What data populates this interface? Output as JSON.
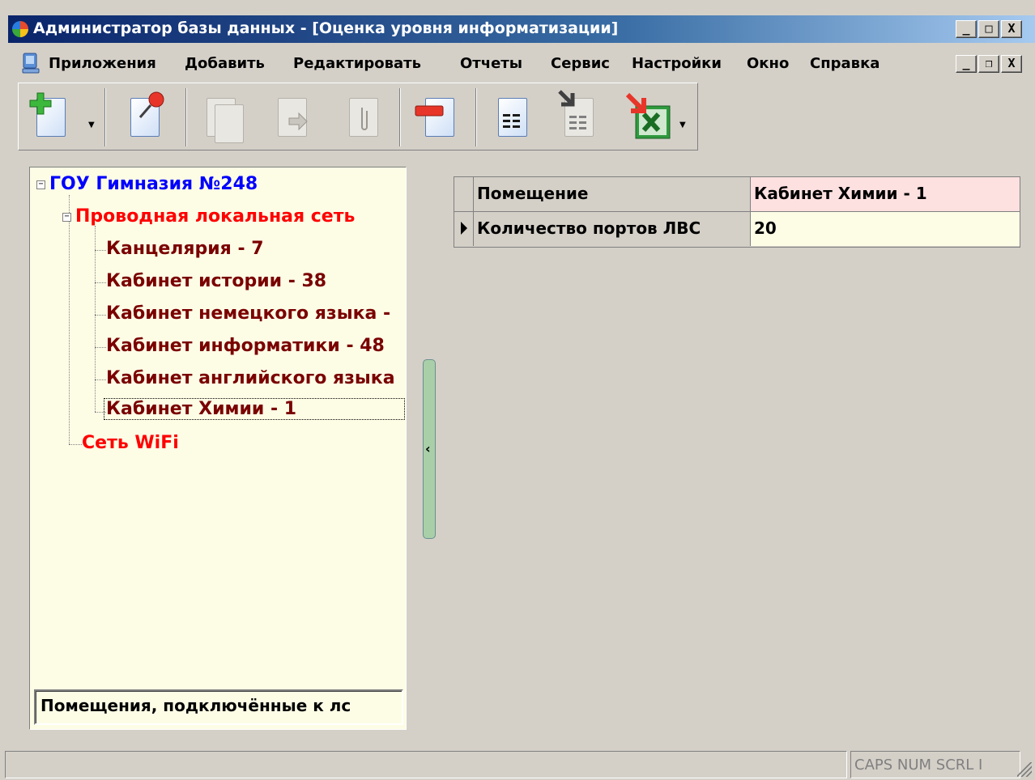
{
  "window": {
    "title": "Администратор базы данных - [Оценка уровня информатизации]",
    "controls": {
      "minimize": "_",
      "maximize": "□",
      "close": "X"
    }
  },
  "menu": {
    "items": [
      "Приложения",
      "Добавить",
      "Редактировать",
      "Отчеты",
      "Сервис",
      "Настройки",
      "Окно",
      "Справка"
    ],
    "child_controls": {
      "minimize": "_",
      "restore": "❐",
      "close": "X"
    }
  },
  "toolbar": {
    "buttons": [
      {
        "icon": "add-document-icon",
        "enabled": true,
        "dropdown": true
      },
      {
        "icon": "pin-document-icon",
        "enabled": true
      },
      {
        "icon": "copy-document-icon",
        "enabled": false
      },
      {
        "icon": "move-document-icon",
        "enabled": false
      },
      {
        "icon": "attach-document-icon",
        "enabled": false
      },
      {
        "icon": "remove-document-icon",
        "enabled": true
      },
      {
        "icon": "report-document-icon",
        "enabled": true
      },
      {
        "icon": "import-report-icon",
        "enabled": true
      },
      {
        "icon": "excel-export-icon",
        "enabled": true,
        "dropdown": true
      }
    ]
  },
  "tree": {
    "root": "ГОУ Гимназия №248",
    "group_wired": "Проводная локальная сеть",
    "leaves": [
      "Канцелярия - 7",
      "Кабинет истории - 38",
      "Кабинет немецкого языка -",
      "Кабинет информатики - 48",
      "Кабинет английского языка",
      "Кабинет Химии - 1"
    ],
    "group_wifi": "Сеть WiFi",
    "selected_index": 5,
    "footer": "Помещения, подключённые к лс"
  },
  "grid": {
    "rows": [
      {
        "name": "Помещение",
        "value": "Кабинет Химии - 1"
      },
      {
        "name": "Количество портов ЛВС",
        "value": "20"
      }
    ],
    "current_row": 1
  },
  "statusbar": {
    "indicators": "CAPS NUM SCRL I"
  },
  "colors": {
    "root": "#0000ff",
    "group": "#ff0000",
    "leaf": "#7a0000",
    "tree_bg": "#fdfde6",
    "grid_row1_value": "#fde0e0",
    "grid_row2_value": "#fdfde6"
  }
}
